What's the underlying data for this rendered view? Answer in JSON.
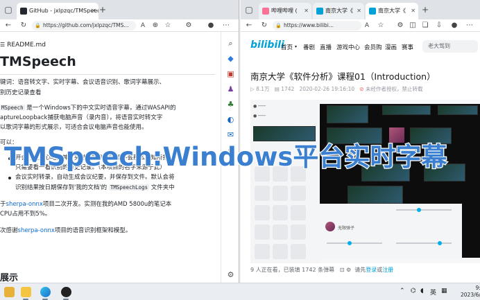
{
  "left_browser": {
    "tabs": [
      {
        "label": "GitHub - jxlpzqc/TMSpeech: 腾讯"
      },
      {
        "label": "+"
      }
    ],
    "address": "https://github.com/jxlpzqc/TMS...",
    "readme_label": "README.md",
    "title": "TMSpeech",
    "keywords": "键词：语音转文字、实时字幕、会议语音识别、歌词字幕展示、",
    "keywords2": "别历史记录查看",
    "intro1_code": "MSpeech",
    "intro1": " 是一个Windows下的中文实时语音字幕，通过WASAPI的",
    "intro2": "aptureLoopback捕获电脑声音（录内音），将语音实时转文字",
    "intro3": "以歌词字幕的形式展示，可适合会议电脑声音也能使用。",
    "can_label": "可以：",
    "bullet1a": "开会时更放心地走神，突然被喊到的时候不会那么不知所措，",
    "bullet1b": "只需要看一看识别的历史记录。（本项目的名字来源于此）",
    "bullet2a": "会议实时转录，自动生成会议纪要，并保存到文件。默认会将",
    "bullet2b": "识别结果按日期保存到'我的文档'的 ",
    "bullet2_code": "TMSpeechLogs",
    "bullet2c": " 文件夹中",
    "based_a": "于",
    "based_link": "sherpa-onnx",
    "based_b": "项目二次开发。实测在我的AMD 5800u的笔记本",
    "cpu": "CPU占用不到5%。",
    "thanks_a": "次感谢",
    "thanks_link": "sherpa-onnx",
    "thanks_b": "项目的语音识别框架和模型。",
    "section": "展示"
  },
  "right_browser": {
    "tabs": [
      {
        "label": "哔哩哔哩 ("
      },
      {
        "label": "南京大学《"
      },
      {
        "label": "南京大学《"
      }
    ],
    "address": "https://www.bilibi...",
    "logo": "bilibili",
    "nav": [
      "首页",
      "番剧",
      "直播",
      "游戏中心",
      "会员购",
      "漫画",
      "赛事"
    ],
    "search_placeholder": "老大驾到",
    "video_title": "南京大学《软件分析》课程01（Introduction）",
    "views": "8.1万",
    "danmaku": "1742",
    "date": "2020-02-26 19:16:10",
    "warning": "未经作者授权，禁止转载",
    "footer_a": "9 人正在看，已装填 1742 条弹幕",
    "footer_b": "请先",
    "footer_login": "登录",
    "footer_or": "或",
    "footer_signup": "注册",
    "panel_label": "无限弹子"
  },
  "overlay_caption": "TMSpeech:Windows平台实时字幕",
  "taskbar": {
    "lang": "英",
    "time": "9:39",
    "date": "2023/6/30"
  },
  "colors": {
    "github_link": "#0969da",
    "bili_blue": "#00a1d6",
    "caption_blue": "#3a7fd0",
    "warning_red": "#f25d59"
  }
}
